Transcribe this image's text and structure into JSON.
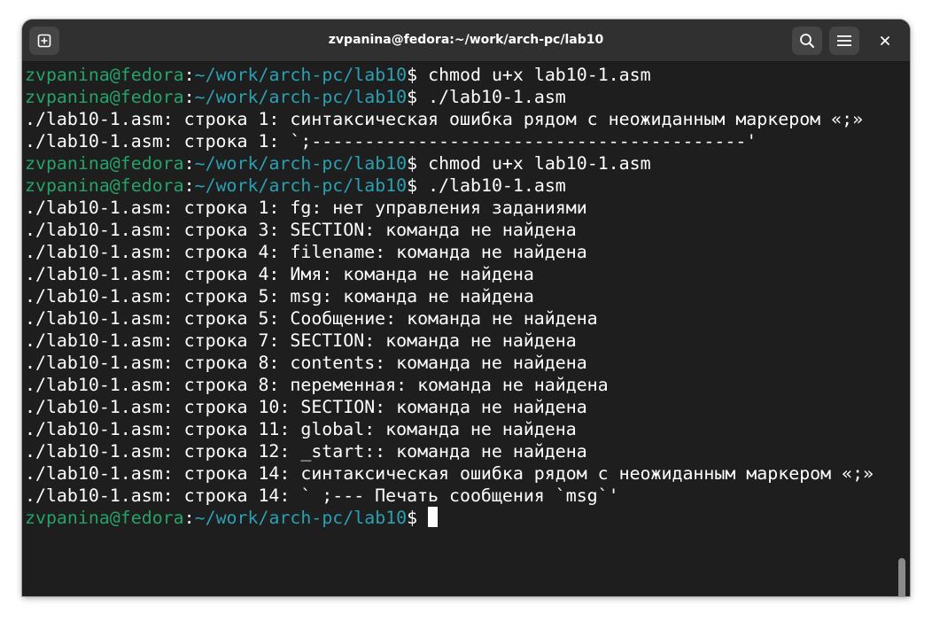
{
  "window": {
    "title": "zvpanina@fedora:~/work/arch-pc/lab10"
  },
  "icons": {
    "new_tab": "new-tab-icon",
    "search": "search-icon",
    "menu": "hamburger-menu-icon",
    "close": "close-icon"
  },
  "colors": {
    "background": "#1e1e1e",
    "titlebar": "#303030",
    "prompt_user": "#26a269",
    "prompt_path": "#2aa1b3",
    "text": "#ffffff"
  },
  "terminal": {
    "lines": [
      {
        "type": "prompt",
        "user": "zvpanina@fedora",
        "sep": ":",
        "path": "~/work/arch-pc/lab10",
        "sym": "$ ",
        "cmd": "chmod u+x lab10-1.asm"
      },
      {
        "type": "prompt",
        "user": "zvpanina@fedora",
        "sep": ":",
        "path": "~/work/arch-pc/lab10",
        "sym": "$ ",
        "cmd": "./lab10-1.asm"
      },
      {
        "type": "output",
        "text": "./lab10-1.asm: строка 1: синтаксическая ошибка рядом с неожиданным маркером «;»"
      },
      {
        "type": "output",
        "text": "./lab10-1.asm: строка 1: `;-----------------------------------------'"
      },
      {
        "type": "prompt",
        "user": "zvpanina@fedora",
        "sep": ":",
        "path": "~/work/arch-pc/lab10",
        "sym": "$ ",
        "cmd": "chmod u+x lab10-1.asm"
      },
      {
        "type": "prompt",
        "user": "zvpanina@fedora",
        "sep": ":",
        "path": "~/work/arch-pc/lab10",
        "sym": "$ ",
        "cmd": "./lab10-1.asm"
      },
      {
        "type": "output",
        "text": "./lab10-1.asm: строка 1: fg: нет управления заданиями"
      },
      {
        "type": "output",
        "text": "./lab10-1.asm: строка 3: SECTION: команда не найдена"
      },
      {
        "type": "output",
        "text": "./lab10-1.asm: строка 4: filename: команда не найдена"
      },
      {
        "type": "output",
        "text": "./lab10-1.asm: строка 4: Имя: команда не найдена"
      },
      {
        "type": "output",
        "text": "./lab10-1.asm: строка 5: msg: команда не найдена"
      },
      {
        "type": "output",
        "text": "./lab10-1.asm: строка 5: Сообщение: команда не найдена"
      },
      {
        "type": "output",
        "text": "./lab10-1.asm: строка 7: SECTION: команда не найдена"
      },
      {
        "type": "output",
        "text": "./lab10-1.asm: строка 8: contents: команда не найдена"
      },
      {
        "type": "output",
        "text": "./lab10-1.asm: строка 8: переменная: команда не найдена"
      },
      {
        "type": "output",
        "text": "./lab10-1.asm: строка 10: SECTION: команда не найдена"
      },
      {
        "type": "output",
        "text": "./lab10-1.asm: строка 11: global: команда не найдена"
      },
      {
        "type": "output",
        "text": "./lab10-1.asm: строка 12: _start:: команда не найдена"
      },
      {
        "type": "output",
        "text": "./lab10-1.asm: строка 14: синтаксическая ошибка рядом с неожиданным маркером «;»"
      },
      {
        "type": "output",
        "text": "./lab10-1.asm: строка 14: ` ;--- Печать сообщения `msg`'"
      },
      {
        "type": "prompt",
        "user": "zvpanina@fedora",
        "sep": ":",
        "path": "~/work/arch-pc/lab10",
        "sym": "$ ",
        "cmd": "",
        "cursor": true
      }
    ]
  }
}
